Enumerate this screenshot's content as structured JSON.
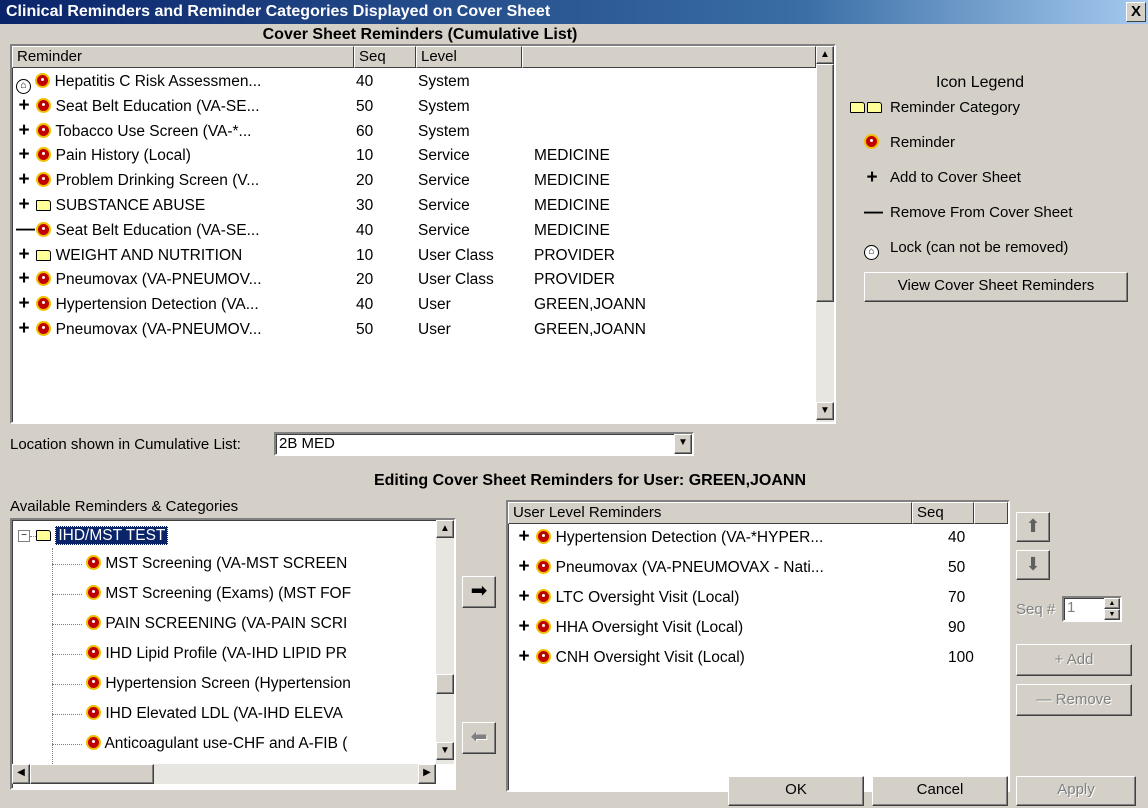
{
  "window": {
    "title": "Clinical Reminders and Reminder Categories Displayed on Cover Sheet",
    "close_label": "X"
  },
  "cumulative": {
    "heading": "Cover Sheet Reminders (Cumulative List)",
    "columns": [
      "Reminder",
      "Seq",
      "Level",
      ""
    ],
    "rows": [
      {
        "action": "lock",
        "icon": "reminder",
        "name": "Hepatitis C Risk Assessmen...",
        "seq": "40",
        "level": "System",
        "value": ""
      },
      {
        "action": "add",
        "icon": "reminder",
        "name": "Seat Belt Education (VA-SE...",
        "seq": "50",
        "level": "System",
        "value": ""
      },
      {
        "action": "add",
        "icon": "reminder",
        "name": "Tobacco Use Screen (VA-*...",
        "seq": "60",
        "level": "System",
        "value": ""
      },
      {
        "action": "add",
        "icon": "reminder",
        "name": "Pain History (Local)",
        "seq": "10",
        "level": "Service",
        "value": "MEDICINE"
      },
      {
        "action": "add",
        "icon": "reminder",
        "name": "Problem Drinking Screen (V...",
        "seq": "20",
        "level": "Service",
        "value": "MEDICINE"
      },
      {
        "action": "add",
        "icon": "category",
        "name": "SUBSTANCE ABUSE",
        "seq": "30",
        "level": "Service",
        "value": "MEDICINE"
      },
      {
        "action": "remove",
        "icon": "reminder",
        "name": "Seat Belt Education (VA-SE...",
        "seq": "40",
        "level": "Service",
        "value": "MEDICINE"
      },
      {
        "action": "add",
        "icon": "category",
        "name": "WEIGHT AND NUTRITION",
        "seq": "10",
        "level": "User Class",
        "value": "PROVIDER"
      },
      {
        "action": "add",
        "icon": "reminder",
        "name": "Pneumovax (VA-PNEUMOV...",
        "seq": "20",
        "level": "User Class",
        "value": "PROVIDER"
      },
      {
        "action": "add",
        "icon": "reminder",
        "name": "Hypertension Detection (VA...",
        "seq": "40",
        "level": "User",
        "value": "GREEN,JOANN"
      },
      {
        "action": "add",
        "icon": "reminder",
        "name": "Pneumovax (VA-PNEUMOV...",
        "seq": "50",
        "level": "User",
        "value": "GREEN,JOANN"
      }
    ]
  },
  "legend": {
    "title": "Icon Legend",
    "items": [
      {
        "icon": "folder",
        "label": "Reminder Category"
      },
      {
        "icon": "reminder",
        "label": "Reminder"
      },
      {
        "icon": "plus",
        "label": "Add to Cover Sheet"
      },
      {
        "icon": "minus",
        "label": "Remove From Cover Sheet"
      },
      {
        "icon": "lock",
        "label": "Lock (can not be removed)"
      }
    ],
    "view_button": "View Cover Sheet Reminders"
  },
  "location": {
    "label": "Location shown in Cumulative List:",
    "value": "2B MED"
  },
  "editing": {
    "heading": "Editing Cover Sheet Reminders for User: GREEN,JOANN"
  },
  "available": {
    "label": "Available Reminders & Categories",
    "root": "IHD/MST TEST",
    "items": [
      "MST Screening (VA-MST SCREEN",
      "MST Screening (Exams) (MST FOF",
      "PAIN SCREENING (VA-PAIN SCRI",
      "IHD Lipid Profile (VA-IHD LIPID PR",
      "Hypertension Screen (Hypertension",
      "IHD Elevated LDL (VA-IHD ELEVA",
      "Anticoagulant use-CHF and A-FIB ("
    ]
  },
  "user_level": {
    "columns": [
      "User Level Reminders",
      "Seq",
      ""
    ],
    "rows": [
      {
        "name": "Hypertension Detection (VA-*HYPER...",
        "seq": "40"
      },
      {
        "name": "Pneumovax (VA-PNEUMOVAX - Nati...",
        "seq": "50"
      },
      {
        "name": "LTC Oversight Visit (Local)",
        "seq": "70"
      },
      {
        "name": "HHA Oversight Visit (Local)",
        "seq": "90"
      },
      {
        "name": "CNH Oversight Visit (Local)",
        "seq": "100"
      }
    ]
  },
  "side_controls": {
    "seq_label": "Seq #",
    "seq_value": "1",
    "add_label": "Add",
    "remove_label": "Remove"
  },
  "footer": {
    "ok": "OK",
    "cancel": "Cancel",
    "apply": "Apply"
  }
}
